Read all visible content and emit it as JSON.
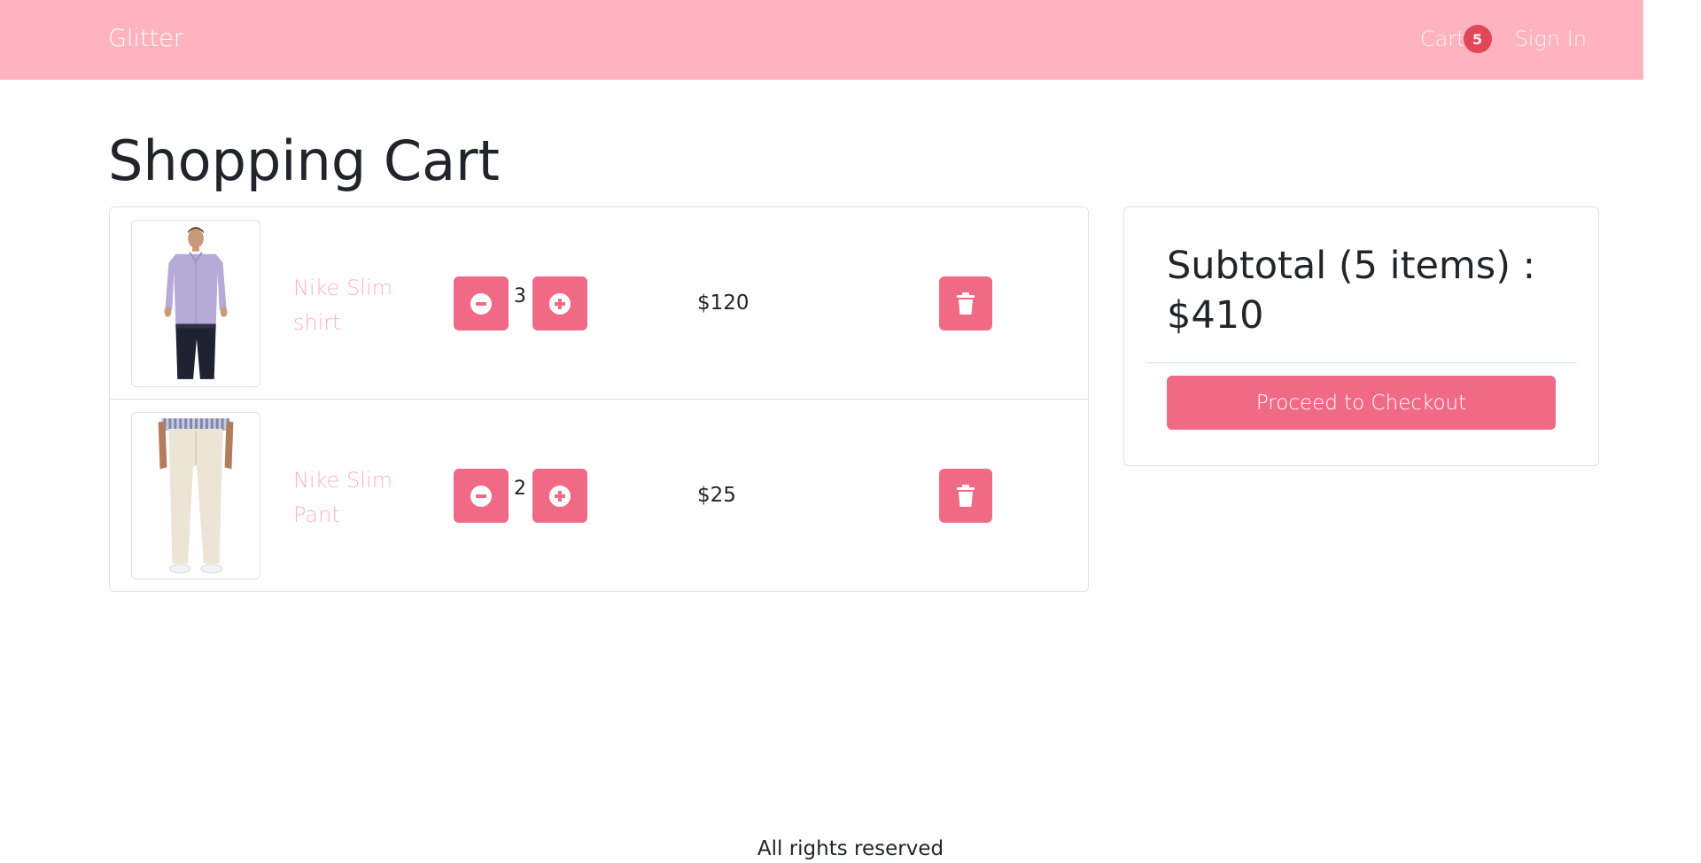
{
  "navbar": {
    "brand": "Glitter",
    "cart_label": "Cart",
    "cart_count": "5",
    "signin_label": "Sign In"
  },
  "page": {
    "title": "Shopping Cart"
  },
  "cart": {
    "items": [
      {
        "name": "Nike Slim shirt",
        "quantity": "3",
        "price": "$120",
        "image": "shirt-product-photo"
      },
      {
        "name": "Nike Slim Pant",
        "quantity": "2",
        "price": "$25",
        "image": "pants-product-photo"
      }
    ]
  },
  "summary": {
    "subtotal_text": "Subtotal (5 items) : $410",
    "checkout_label": "Proceed to Checkout"
  },
  "footer": {
    "text": "All rights reserved"
  },
  "colors": {
    "navbar": "#ffb3be",
    "accent": "#f06a86",
    "badge": "#dc3545",
    "link": "#ffb3be"
  },
  "icons": {
    "minus": "minus-circle-icon",
    "plus": "plus-circle-icon",
    "delete": "trash-icon"
  }
}
